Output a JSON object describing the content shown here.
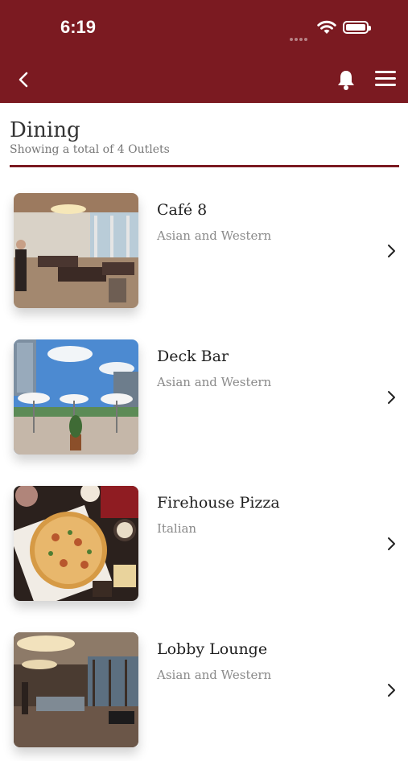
{
  "status": {
    "time": "6:19"
  },
  "header": {
    "title": "Dining",
    "subtitle": "Showing a total of 4 Outlets"
  },
  "colors": {
    "brand": "#7b1a21"
  },
  "icons": [
    "back-icon",
    "bell-icon",
    "menu-icon",
    "chevron-right-icon",
    "wifi-icon",
    "battery-icon"
  ],
  "outlets": [
    {
      "name": "Café 8",
      "cuisine": "Asian and Western"
    },
    {
      "name": "Deck Bar",
      "cuisine": "Asian and Western"
    },
    {
      "name": "Firehouse Pizza",
      "cuisine": "Italian"
    },
    {
      "name": "Lobby Lounge",
      "cuisine": "Asian and Western"
    }
  ]
}
